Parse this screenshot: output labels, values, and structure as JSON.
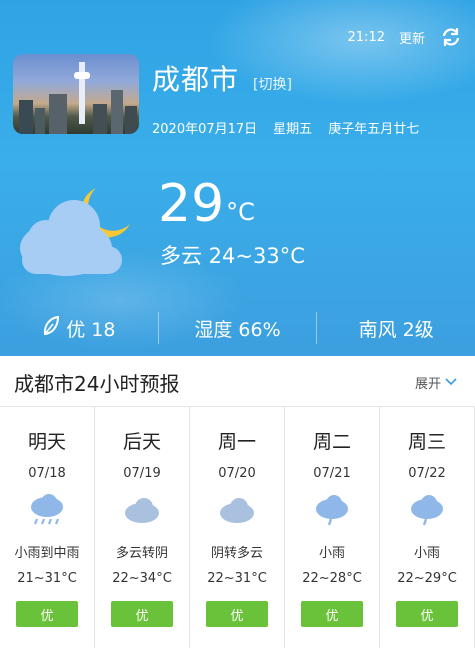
{
  "header": {
    "time": "21:12",
    "update_label": "更新",
    "city": "成都市",
    "switch_label": "[切换]",
    "date": "2020年07月17日",
    "weekday": "星期五",
    "lunar": "庚子年五月廿七"
  },
  "current": {
    "temperature": "29",
    "unit": "°C",
    "condition": "多云 24~33°C",
    "icon": "cloudy-night-icon"
  },
  "stats": {
    "aqi": "优 18",
    "humidity": "湿度 66%",
    "wind": "南风 2级"
  },
  "forecast": {
    "title": "成都市24小时预报",
    "expand_label": "展开",
    "days": [
      {
        "name": "明天",
        "date": "07/18",
        "icon": "rain-cloud-icon",
        "condition": "小雨到中雨",
        "temp": "21~31°C",
        "aqi": "优"
      },
      {
        "name": "后天",
        "date": "07/19",
        "icon": "cloud-icon",
        "condition": "多云转阴",
        "temp": "22~34°C",
        "aqi": "优"
      },
      {
        "name": "周一",
        "date": "07/20",
        "icon": "cloud-icon",
        "condition": "阴转多云",
        "temp": "22~31°C",
        "aqi": "优"
      },
      {
        "name": "周二",
        "date": "07/21",
        "icon": "light-rain-icon",
        "condition": "小雨",
        "temp": "22~28°C",
        "aqi": "优"
      },
      {
        "name": "周三",
        "date": "07/22",
        "icon": "light-rain-icon",
        "condition": "小雨",
        "temp": "22~29°C",
        "aqi": "优"
      }
    ]
  },
  "colors": {
    "sky": "#3aaeea",
    "aqi_good": "#6ac23a",
    "cloud_icon": "#8fb8e8"
  }
}
